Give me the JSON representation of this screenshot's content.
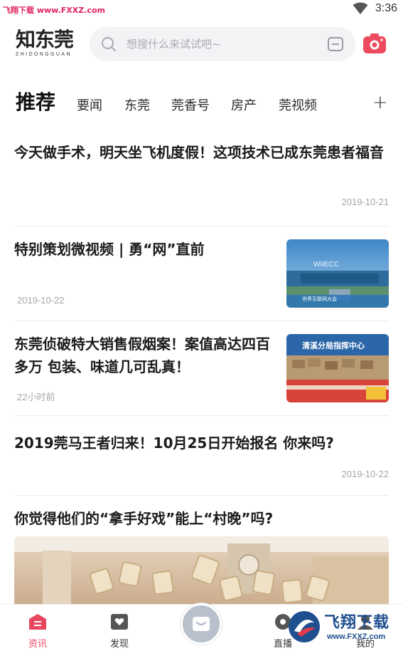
{
  "status_bar": {
    "watermark": "飞翔下载 www.FXXZ.com",
    "time": "3:36"
  },
  "header": {
    "logo_cn": "知东莞",
    "logo_en": "ZHIDONGGUAN",
    "search_placeholder": "想搜什么来试试吧~",
    "icons": [
      "search-icon",
      "scan-icon",
      "camera-icon"
    ]
  },
  "tabs": {
    "items": [
      "推荐",
      "要闻",
      "东莞",
      "莞香号",
      "房产",
      "莞视频"
    ],
    "active": "推荐",
    "plus": "+"
  },
  "feed": [
    {
      "title": "今天做手术，明天坐飞机度假！这项技术已成东莞患者福音",
      "date": "2019-10-21"
    },
    {
      "title": "特别策划微视频 | 勇“网”直前",
      "date": "2019-10-22",
      "thumb_text": "WIIECC",
      "thumb_caption": "世界互联网大会"
    },
    {
      "title": "东莞侦破特大销售假烟案！案值高达四百多万 包装、味道几可乱真！",
      "date": "22小时前",
      "thumb_text": "清溪分局指挥中心"
    },
    {
      "title": "2019莞马王者归来！10月25日开始报名 你来吗?",
      "date": "2019-10-22"
    },
    {
      "title": "你觉得他们的“拿手好戏”能上“村晚”吗?"
    }
  ],
  "bottom_nav": {
    "items": [
      "资讯",
      "发现",
      "直播",
      "我的"
    ],
    "active": "资讯"
  },
  "watermark_bottom": {
    "brand": "飞翔下载",
    "url": "www.FXXZ.com"
  },
  "colors": {
    "accent": "#e8475f",
    "watermark": "#e0245e"
  }
}
